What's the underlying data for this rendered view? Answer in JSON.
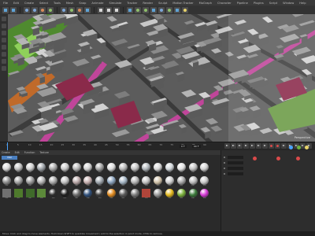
{
  "menubar": {
    "items": [
      "File",
      "Edit",
      "Create",
      "Select",
      "Tools",
      "Mesh",
      "Snap",
      "Animate",
      "Simulate",
      "Tracker",
      "Render",
      "Sculpt",
      "Motion Tracker",
      "MoGraph",
      "Character",
      "Pipeline",
      "Plugins",
      "Script",
      "Window",
      "Help"
    ]
  },
  "viewport": {
    "label": "Perspective",
    "accent_colors": {
      "road_pink": "#c0459a",
      "grass": "#6fb23f",
      "road_orange": "#d98a3a"
    }
  },
  "timeline": {
    "ticks": [
      "0",
      "5",
      "10",
      "15",
      "20",
      "25",
      "30",
      "35",
      "40",
      "45",
      "50",
      "55",
      "60",
      "65",
      "70",
      "75",
      "80",
      "85",
      "90"
    ],
    "current_frame": "0 F",
    "end_frame": "90 F"
  },
  "materials": {
    "menu": [
      "Create",
      "Edit",
      "Function",
      "Texture"
    ],
    "tab_label": "Mat",
    "rows": [
      [
        {
          "name": "Mat",
          "color": "#d8d8d8",
          "kind": "ball"
        },
        {
          "name": "Mat",
          "color": "#bfbfbf",
          "kind": "ball"
        },
        {
          "name": "Mat",
          "color": "#cfcfcf",
          "kind": "ball"
        },
        {
          "name": "Mat",
          "color": "#9ea3a8",
          "kind": "ball"
        },
        {
          "name": "Mat",
          "color": "#a9a9a9",
          "kind": "ball"
        },
        {
          "name": "Mat",
          "color": "#c9c9c9",
          "kind": "ball"
        },
        {
          "name": "Mat",
          "color": "#b5b5b5",
          "kind": "ball"
        },
        {
          "name": "Mat",
          "color": "#d0d0d0",
          "kind": "ball"
        },
        {
          "name": "Mat",
          "color": "#a3a3a3",
          "kind": "ball"
        },
        {
          "name": "Mat",
          "color": "#dcdcdc",
          "kind": "ball"
        },
        {
          "name": "Mat",
          "color": "#b8b8b8",
          "kind": "ball"
        },
        {
          "name": "Mat",
          "color": "#c4c4c4",
          "kind": "ball"
        },
        {
          "name": "Mat",
          "color": "#b0b6bb",
          "kind": "ball"
        },
        {
          "name": "Mat",
          "color": "#d6d6d6",
          "kind": "ball"
        },
        {
          "name": "Mat",
          "color": "#cfd4d8",
          "kind": "ball"
        },
        {
          "name": "Mat",
          "color": "#e0e0e0",
          "kind": "ball"
        },
        {
          "name": "Mat",
          "color": "#c2c2c2",
          "kind": "ball"
        },
        {
          "name": "Mat",
          "color": "#d2d2d2",
          "kind": "ball"
        }
      ],
      [
        {
          "name": "Mat",
          "color": "#8e8e8e",
          "kind": "ball"
        },
        {
          "name": "Mat",
          "color": "#a2a2a2",
          "kind": "ball"
        },
        {
          "name": "Mat",
          "color": "#9b9b9b",
          "kind": "ball"
        },
        {
          "name": "Mat",
          "color": "#b4b4b4",
          "kind": "ball"
        },
        {
          "name": "Mat",
          "color": "#aaaaaa",
          "kind": "ball"
        },
        {
          "name": "Mat",
          "color": "#c2c2c2",
          "kind": "ball"
        },
        {
          "name": "Mat",
          "color": "#b9a7a7",
          "kind": "ball"
        },
        {
          "name": "Mat",
          "color": "#c7b0b0",
          "kind": "ball"
        },
        {
          "name": "Mat",
          "color": "#9fa6ad",
          "kind": "ball"
        },
        {
          "name": "Mat",
          "color": "#8ba3bd",
          "kind": "ball"
        },
        {
          "name": "Mat",
          "color": "#a6b7c6",
          "kind": "ball"
        },
        {
          "name": "Mat",
          "color": "#b4b4b4",
          "kind": "ball"
        },
        {
          "name": "Mat",
          "color": "#c3c3c3",
          "kind": "ball"
        },
        {
          "name": "Mat",
          "color": "#d1c2a8",
          "kind": "ball"
        },
        {
          "name": "Mat",
          "color": "#cfcfcf",
          "kind": "ball"
        },
        {
          "name": "Mat",
          "color": "#a8a8a8",
          "kind": "ball"
        },
        {
          "name": "Mat",
          "color": "#bcbcbc",
          "kind": "ball"
        },
        {
          "name": "Mat",
          "color": "#c9c9c9",
          "kind": "ball"
        }
      ],
      [
        {
          "name": "Mat",
          "color": "#707070",
          "kind": "sq"
        },
        {
          "name": "Mat",
          "color": "#4e7a2c",
          "kind": "sq"
        },
        {
          "name": "Mat",
          "color": "#3f6a2a",
          "kind": "sq"
        },
        {
          "name": "Mat",
          "color": "#5c8a3a",
          "kind": "sq"
        },
        {
          "name": "Mat",
          "color": "#2c2c2c",
          "kind": "ball"
        },
        {
          "name": "Mat",
          "color": "#1e1e1e",
          "kind": "ball"
        },
        {
          "name": "Mat",
          "color": "#6b6b6b",
          "kind": "ball"
        },
        {
          "name": "Mat",
          "color": "#2f4f7a",
          "kind": "ball"
        },
        {
          "name": "Mat",
          "color": "#3b3b3b",
          "kind": "ball"
        },
        {
          "name": "Mat",
          "color": "#e08a1e",
          "kind": "ball"
        },
        {
          "name": "Mat",
          "color": "#595959",
          "kind": "ball"
        },
        {
          "name": "Mat",
          "color": "#7a7a7a",
          "kind": "ball"
        },
        {
          "name": "Mat",
          "color": "#b0453a",
          "kind": "sq"
        },
        {
          "name": "Mat",
          "color": "#9a9a9a",
          "kind": "ball"
        },
        {
          "name": "Mat",
          "color": "#e3b81c",
          "kind": "ball"
        },
        {
          "name": "Mat",
          "color": "#7ab03a",
          "kind": "ball"
        },
        {
          "name": "Mat",
          "color": "#3a7a3a",
          "kind": "ball"
        },
        {
          "name": "Mat",
          "color": "#d63ad6",
          "kind": "ball"
        }
      ]
    ]
  },
  "status": {
    "text": "Move: Click and drag to move elements. Hold down SHIFT to quantize movement / add to the selection in point mode, CTRL to remove."
  }
}
